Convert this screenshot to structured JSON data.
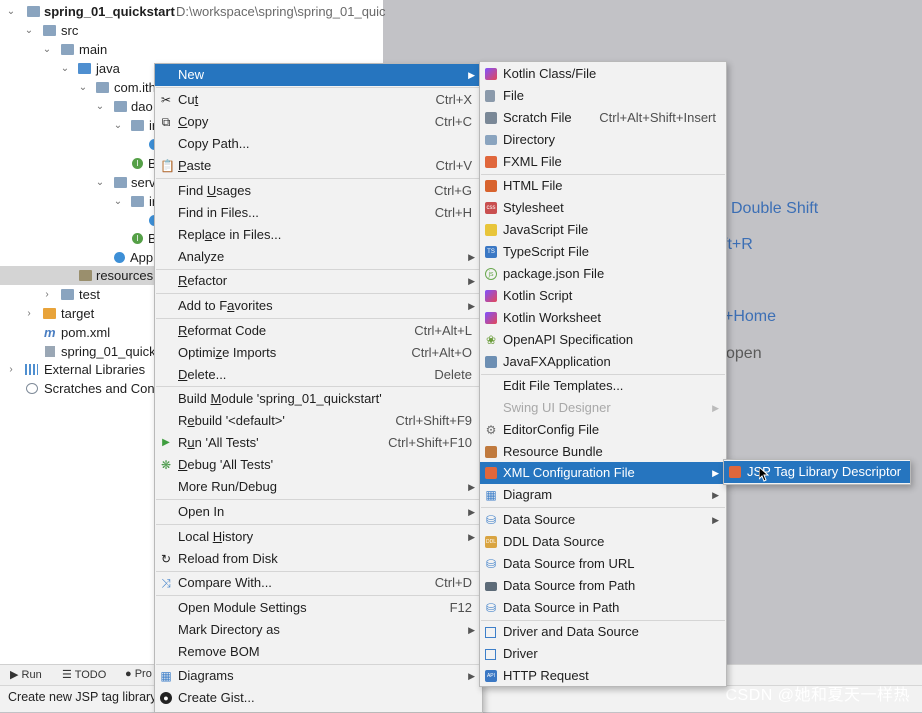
{
  "project_tree": {
    "root_name": "spring_01_quickstart",
    "root_path": "D:\\workspace\\spring\\spring_01_quic",
    "items": {
      "src": "src",
      "main": "main",
      "java": "java",
      "com": "com.ith",
      "dao": "dao",
      "dao_impl": "ir",
      "bookdao": "B",
      "service": "serv",
      "service_impl": "ir",
      "bookservice": "B",
      "app": "App",
      "resources": "resources",
      "test": "test",
      "target": "target",
      "pom": "pom.xml",
      "iml": "spring_01_quicks",
      "external": "External Libraries",
      "scratches": "Scratches and Cons"
    }
  },
  "background_hints": [
    "Double Shift",
    "ft+R",
    "+Home",
    "open"
  ],
  "context_menu": {
    "items": [
      {
        "label": "New",
        "arrow": true,
        "highlight": true
      },
      {
        "label": "Cut",
        "shortcut": "Ctrl+X",
        "icon": "scissors-icon"
      },
      {
        "label": "Copy",
        "shortcut": "Ctrl+C",
        "icon": "copy-icon"
      },
      {
        "label": "Copy Path..."
      },
      {
        "label": "Paste",
        "shortcut": "Ctrl+V",
        "icon": "paste-icon"
      },
      {
        "label": "Find Usages",
        "shortcut": "Ctrl+G"
      },
      {
        "label": "Find in Files...",
        "shortcut": "Ctrl+H"
      },
      {
        "label": "Replace in Files..."
      },
      {
        "label": "Analyze",
        "arrow": true
      },
      {
        "label": "Refactor",
        "arrow": true
      },
      {
        "label": "Add to Favorites",
        "arrow": true
      },
      {
        "label": "Reformat Code",
        "shortcut": "Ctrl+Alt+L"
      },
      {
        "label": "Optimize Imports",
        "shortcut": "Ctrl+Alt+O"
      },
      {
        "label": "Delete...",
        "shortcut": "Delete"
      },
      {
        "label": "Build Module 'spring_01_quickstart'"
      },
      {
        "label": "Rebuild '<default>'",
        "shortcut": "Ctrl+Shift+F9"
      },
      {
        "label": "Run 'All Tests'",
        "shortcut": "Ctrl+Shift+F10",
        "icon": "run-icon"
      },
      {
        "label": "Debug 'All Tests'",
        "icon": "debug-icon"
      },
      {
        "label": "More Run/Debug",
        "arrow": true
      },
      {
        "label": "Open In",
        "arrow": true
      },
      {
        "label": "Local History",
        "arrow": true
      },
      {
        "label": "Reload from Disk",
        "icon": "reload-icon"
      },
      {
        "label": "Compare With...",
        "shortcut": "Ctrl+D",
        "icon": "compare-icon"
      },
      {
        "label": "Open Module Settings",
        "shortcut": "F12"
      },
      {
        "label": "Mark Directory as",
        "arrow": true
      },
      {
        "label": "Remove BOM"
      },
      {
        "label": "Diagrams",
        "arrow": true,
        "icon": "diagram-icon"
      },
      {
        "label": "Create Gist...",
        "icon": "github-icon"
      }
    ]
  },
  "new_submenu": {
    "items": [
      {
        "label": "Kotlin Class/File",
        "icon": "kotlin-icon"
      },
      {
        "label": "File",
        "icon": "file-icon"
      },
      {
        "label": "Scratch File",
        "shortcut": "Ctrl+Alt+Shift+Insert",
        "icon": "scratch-icon"
      },
      {
        "label": "Directory",
        "icon": "folder-icon"
      },
      {
        "label": "FXML File",
        "icon": "fxml-icon"
      },
      {
        "label": "HTML File",
        "icon": "html-icon"
      },
      {
        "label": "Stylesheet",
        "icon": "css-icon"
      },
      {
        "label": "JavaScript File",
        "icon": "js-icon"
      },
      {
        "label": "TypeScript File",
        "icon": "ts-icon"
      },
      {
        "label": "package.json File",
        "icon": "package-icon"
      },
      {
        "label": "Kotlin Script",
        "icon": "kotlin-icon"
      },
      {
        "label": "Kotlin Worksheet",
        "icon": "kotlin-icon"
      },
      {
        "label": "OpenAPI Specification",
        "icon": "openapi-icon"
      },
      {
        "label": "JavaFXApplication",
        "icon": "javafx-icon"
      },
      {
        "label": "Edit File Templates..."
      },
      {
        "label": "Swing UI Designer",
        "arrow": true,
        "disabled": true
      },
      {
        "label": "EditorConfig File",
        "icon": "gear-icon"
      },
      {
        "label": "Resource Bundle",
        "icon": "bundle-icon"
      },
      {
        "label": "XML Configuration File",
        "arrow": true,
        "highlight": true,
        "icon": "xml-icon"
      },
      {
        "label": "Diagram",
        "arrow": true,
        "icon": "diagram-icon"
      },
      {
        "label": "Data Source",
        "arrow": true,
        "icon": "database-icon"
      },
      {
        "label": "DDL Data Source",
        "icon": "ddl-icon"
      },
      {
        "label": "Data Source from URL",
        "icon": "database-icon"
      },
      {
        "label": "Data Source from Path",
        "icon": "folder-open-icon"
      },
      {
        "label": "Data Source in Path",
        "icon": "database-icon"
      },
      {
        "label": "Driver and Data Source",
        "icon": "driver-icon"
      },
      {
        "label": "Driver",
        "icon": "driver-icon"
      },
      {
        "label": "HTTP Request",
        "icon": "api-icon"
      }
    ]
  },
  "xml_submenu": {
    "label": "JSP Tag Library Descriptor"
  },
  "bottom_tabs": {
    "run": "Run",
    "todo": "TODO",
    "problems": "Pro"
  },
  "status_text": "Create new JSP tag library",
  "watermark": "CSDN @她和夏天一样热",
  "colors": {
    "highlight": "#2675bf",
    "hint_blue": "#3c6fb5",
    "menu_bg": "#f2f2f2"
  }
}
